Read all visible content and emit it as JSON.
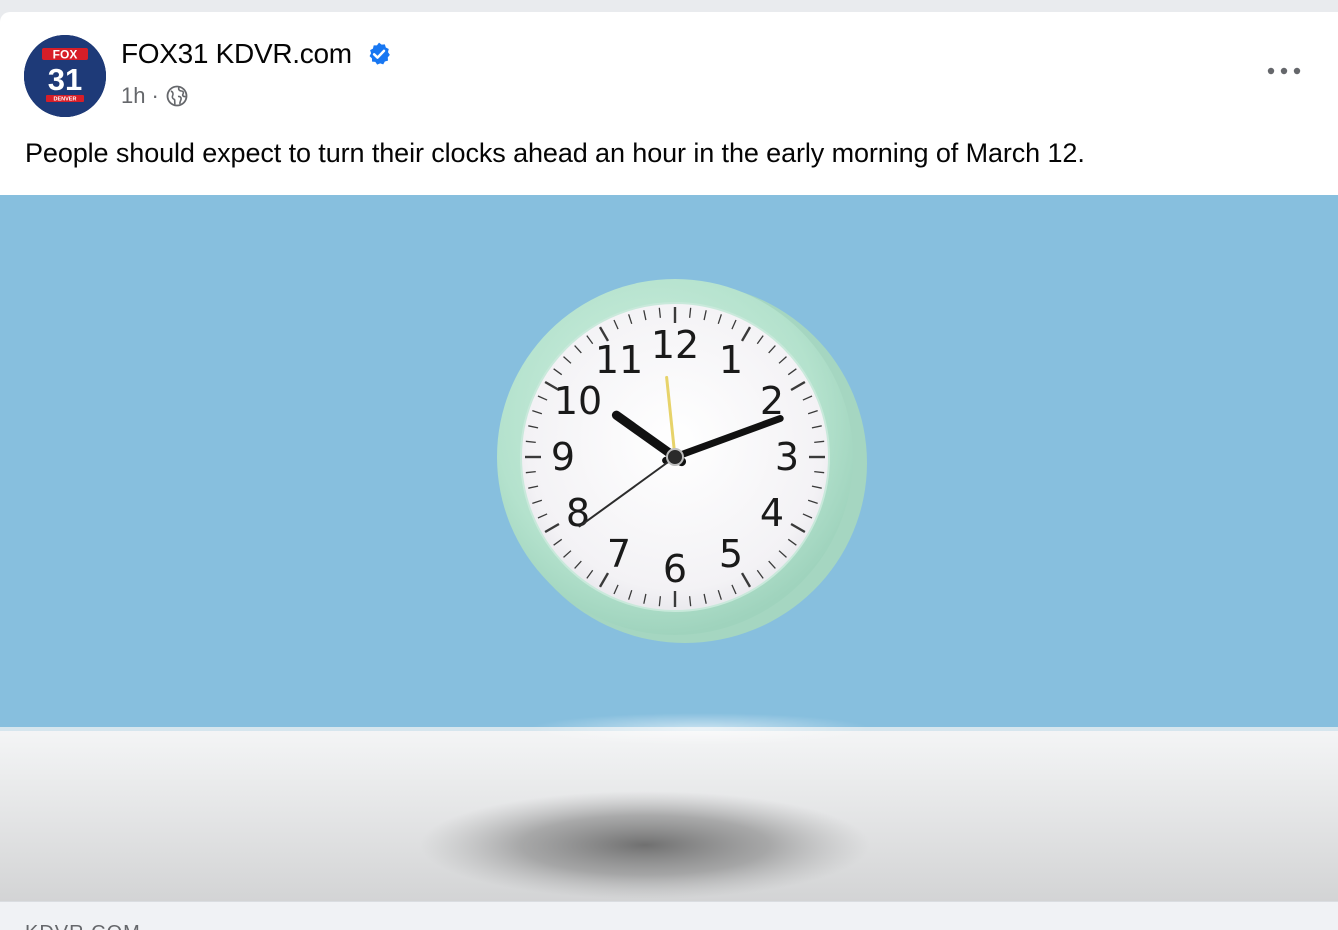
{
  "post": {
    "page_name": "FOX31 KDVR.com",
    "avatar": {
      "brand": "FOX",
      "number": "31",
      "city": "DENVER"
    },
    "timestamp": "1h",
    "separator": "·",
    "visibility_icon": "globe-icon",
    "verified_icon": "verified-badge-icon",
    "more_icon": "more-options-icon",
    "text": "People should expect to turn their clocks ahead an hour in the early morning of March 12.",
    "link_domain": "KDVR.COM"
  },
  "image": {
    "subject": "analog alarm clock",
    "clock_time": {
      "hours": 10,
      "minutes": 11,
      "seconds": 39
    },
    "numerals": [
      "12",
      "1",
      "2",
      "3",
      "4",
      "5",
      "6",
      "7",
      "8",
      "9",
      "10",
      "11"
    ]
  },
  "colors": {
    "sky_blue": "#87bfde",
    "floor": "#e3e4e5",
    "clock_rim": "#b6e3cf",
    "verified_blue": "#1877f2",
    "text_primary": "#050505",
    "text_secondary": "#65676b",
    "fox_navy": "#1e3a78",
    "fox_red": "#d71e28"
  }
}
